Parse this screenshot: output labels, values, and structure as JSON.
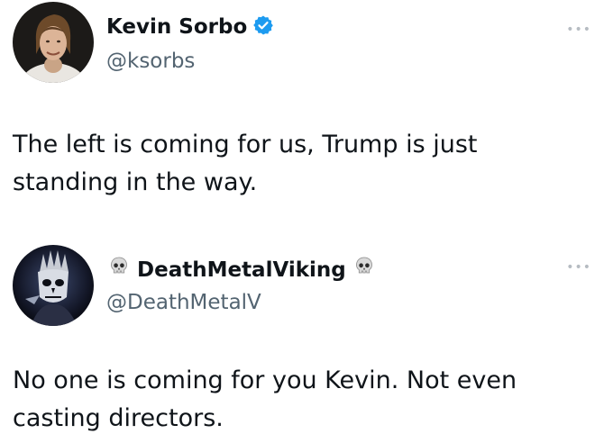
{
  "tweets": [
    {
      "display_name": "Kevin Sorbo",
      "handle": "@ksorbs",
      "verified": true,
      "verified_color": "#1d9bf0",
      "more_icon": "ellipsis-icon",
      "text": "The left is coming for us, Trump is just standing in the way."
    },
    {
      "display_name": "DeathMetalViking",
      "name_prefix_emoji": "skull",
      "name_suffix_emoji": "skull",
      "handle": "@DeathMetalV",
      "verified": false,
      "more_icon": "ellipsis-icon",
      "text": "No one is coming for you Kevin. Not even casting directors."
    }
  ],
  "colors": {
    "text": "#0f1419",
    "handle": "#536471",
    "background": "#ffffff"
  }
}
